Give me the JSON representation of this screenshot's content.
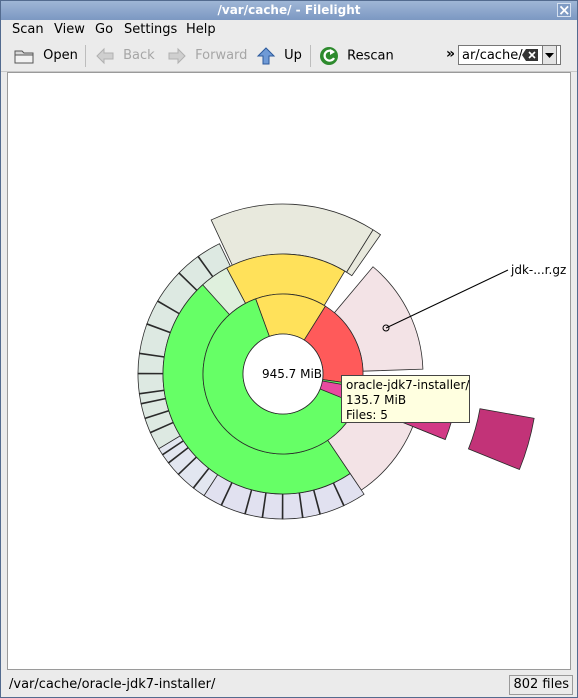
{
  "window": {
    "title": "/var/cache/ - Filelight"
  },
  "menu": [
    {
      "label": "Scan"
    },
    {
      "label": "View"
    },
    {
      "label": "Go"
    },
    {
      "label": "Settings"
    },
    {
      "label": "Help"
    }
  ],
  "toolbar": {
    "open": "Open",
    "back": "Back",
    "forward": "Forward",
    "up": "Up",
    "rescan": "Rescan",
    "more": "»",
    "location_value": "ar/cache/"
  },
  "chart": {
    "center_label": "945.7 MiB",
    "segment_label": "jdk-...r.gz"
  },
  "tooltip": {
    "name": "oracle-jdk7-installer/",
    "size": "135.7 MiB",
    "files": "Files: 5"
  },
  "status": {
    "path": "/var/cache/oracle-jdk7-installer/",
    "files": "802 files"
  }
}
